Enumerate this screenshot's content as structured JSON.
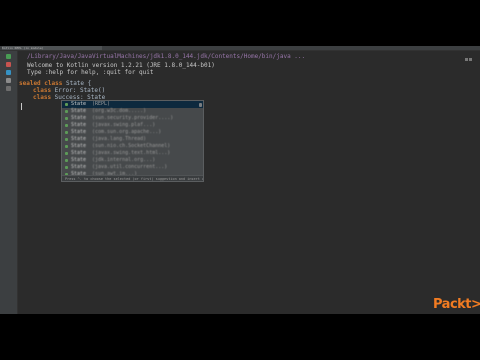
{
  "ide": {
    "tab_title": "Kotlin REPL (in module)",
    "console": {
      "command_line": "/Library/Java/JavaVirtualMachines/jdk1.8.0_144.jdk/Contents/Home/bin/java ...",
      "welcome_line": "Welcome to Kotlin version 1.2.21 (JRE 1.8.0_144-b01)",
      "help_line": "Type :help for help, :quit for quit"
    },
    "code": {
      "line1": {
        "keyword": "sealed class",
        "rest": " State {"
      },
      "line2": {
        "keyword": "class",
        "rest": " Error: State()"
      },
      "line3": {
        "keyword": "class",
        "rest": " Success: State"
      }
    },
    "completion": {
      "items": [
        {
          "name": "State",
          "signature": "(REPL)"
        },
        {
          "name": "State",
          "signature": "(org.w3c.dom.....)"
        },
        {
          "name": "State",
          "signature": "(sun.security.provider....)"
        },
        {
          "name": "State",
          "signature": "(javax.swing.plaf...)"
        },
        {
          "name": "State",
          "signature": "(com.sun.org.apache...)"
        },
        {
          "name": "State",
          "signature": "(java.lang.Thread)"
        },
        {
          "name": "State",
          "signature": "(sun.nio.ch.SocketChannel)"
        },
        {
          "name": "State",
          "signature": "(javax.swing.text.html...)"
        },
        {
          "name": "State",
          "signature": "(jdk.internal.org...)"
        },
        {
          "name": "State",
          "signature": "(java.util.concurrent...)"
        },
        {
          "name": "State",
          "signature": "(sun.awt.im...)"
        }
      ],
      "hint": "Press ^. to choose the selected (or first) suggestion and insert a dot afterwards"
    }
  },
  "brand": {
    "logo_text": "Packt>",
    "accent": "#f27c22"
  }
}
